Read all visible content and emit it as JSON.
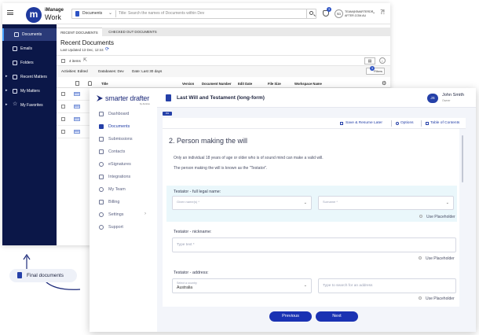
{
  "imanage": {
    "brand": {
      "top": "iManage",
      "bottom": "Work"
    },
    "search": {
      "scope": "Documents",
      "placeholder": "Title: Search the names of Documents within Dev"
    },
    "notifications_count": "3",
    "user": {
      "initials": "SD",
      "line1": "TEAM@SMARTERDR",
      "line2": "AFTER.COM.AU"
    },
    "sidebar": [
      {
        "label": "Documents",
        "active": true
      },
      {
        "label": "Emails"
      },
      {
        "label": "Folders"
      },
      {
        "label": "Recent Matters"
      },
      {
        "label": "My Matters"
      },
      {
        "label": "My Favorites"
      }
    ],
    "tabs": [
      {
        "label": "RECENT DOCUMENTS"
      },
      {
        "label": "CHECKED OUT DOCUMENTS"
      }
    ],
    "title": "Recent Documents",
    "last_updated": "Last Updated 13 Dec, 12:44",
    "items_count": "4 items",
    "filters": [
      "Activities: Edited",
      "Databases: Dev",
      "Date: Last 30 days"
    ],
    "filters_button": "Filters",
    "filters_count": "3",
    "columns": [
      "Title",
      "Version",
      "Document Number",
      "Edit Date",
      "File Size",
      "Workspace Name"
    ],
    "doc_icon_label": "DOC"
  },
  "drafter": {
    "logo": "smarter drafter",
    "logo_sub": "by Amicus",
    "nav": [
      {
        "label": "Dashboard"
      },
      {
        "label": "Documents",
        "active": true
      },
      {
        "label": "Submissions"
      },
      {
        "label": "Contacts"
      },
      {
        "label": "eSignatures"
      },
      {
        "label": "Integrations"
      },
      {
        "label": "My Team"
      },
      {
        "label": "Billing"
      },
      {
        "label": "Settings"
      },
      {
        "label": "Support"
      }
    ],
    "doc_title": "Last Will and Testament (long-form)",
    "user": {
      "initials": "JS",
      "name": "John Smith",
      "role": "Owner"
    },
    "progress_label": "0%",
    "toolbar": {
      "save": "Save & Resume Later",
      "options": "Options",
      "toc": "Table of Contents"
    },
    "section_title": "2. Person making the will",
    "para1": "Only an individual 18 years of age or older who is of sound mind can make a valid will.",
    "para2": "The person making the will is known as the \"Testator\".",
    "q_fullname": {
      "label": "Testator - full legal name:",
      "given_ph": "Given name(s) *",
      "surname_ph": "Surname *",
      "toggle": "Use Placeholder"
    },
    "q_nickname": {
      "label": "Testator - nickname:",
      "ph": "Type text *",
      "toggle": "Use Placeholder"
    },
    "q_address": {
      "label": "Testator - address:",
      "country_ph": "Select a country",
      "country_val": "Australia",
      "address_ph": "Type to search for an address",
      "toggle": "Use Placeholder"
    },
    "buttons": {
      "previous": "Previous",
      "next": "Next"
    }
  },
  "annotation": {
    "label": "Final documents"
  },
  "colors": {
    "navy": "#0b1748",
    "accent": "#2540a8",
    "button": "#1a32b3"
  }
}
